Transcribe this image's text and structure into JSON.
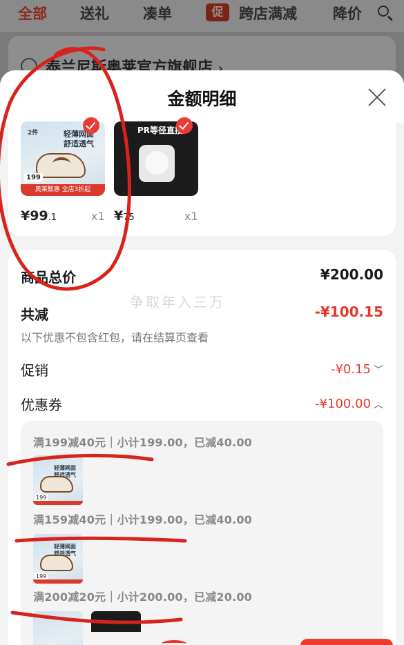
{
  "nav": {
    "tabs": [
      "全部",
      "送礼",
      "凑单",
      "跨店满减",
      "降价"
    ],
    "badge": "促"
  },
  "shop": {
    "name": "泰兰尼斯奥莱官方旗舰店",
    "chevron": "›"
  },
  "sheet": {
    "title": "金额明细",
    "products": [
      {
        "image_text": "轻薄网面\n舒适透气",
        "image_badge": "2件",
        "image_price": "199",
        "image_tag": "奥莱甄惠 全店3折起",
        "price_main": "¥99",
        "price_decimal": ".1",
        "qty": "x1"
      },
      {
        "image_text": "PR等径直接",
        "price_main": "¥",
        "price_decimal": "75",
        "qty": "x1"
      }
    ],
    "summary": {
      "total_label": "商品总价",
      "total_value": "¥200.00",
      "reduce_label": "共减",
      "reduce_value": "-¥100.15",
      "reduce_note": "以下优惠不包含红包，请在结算页查看",
      "promo_label": "促销",
      "promo_value": "-¥0.15",
      "promo_chevron": "﹀",
      "coupon_label": "优惠券",
      "coupon_value": "-¥100.00",
      "coupon_chevron": "︿"
    },
    "coupons": [
      {
        "text": "满199减40元｜小计199.00，已减40.00"
      },
      {
        "text": "满159减40元｜小计199.00，已减40.00"
      },
      {
        "text": "满200减20元｜小计200.00，已减20.00"
      }
    ],
    "thumb_text": "轻薄网面\n舒适透气",
    "thumb_price": "199",
    "watermark": "争取年入三万"
  },
  "colors": {
    "accent_red": "#e8362c",
    "annotation_red": "#d8231d"
  }
}
